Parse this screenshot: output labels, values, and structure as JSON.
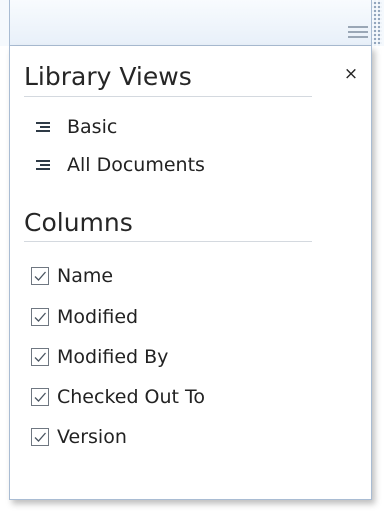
{
  "panel": {
    "library_views": {
      "title": "Library Views",
      "close_label": "×",
      "items": [
        {
          "label": "Basic",
          "icon": "list-view-icon"
        },
        {
          "label": "All Documents",
          "icon": "list-view-icon"
        }
      ]
    },
    "columns": {
      "title": "Columns",
      "items": [
        {
          "label": "Name",
          "checked": true
        },
        {
          "label": "Modified",
          "checked": true
        },
        {
          "label": "Modified By",
          "checked": true
        },
        {
          "label": "Checked Out To",
          "checked": true
        },
        {
          "label": "Version",
          "checked": true
        }
      ]
    }
  }
}
